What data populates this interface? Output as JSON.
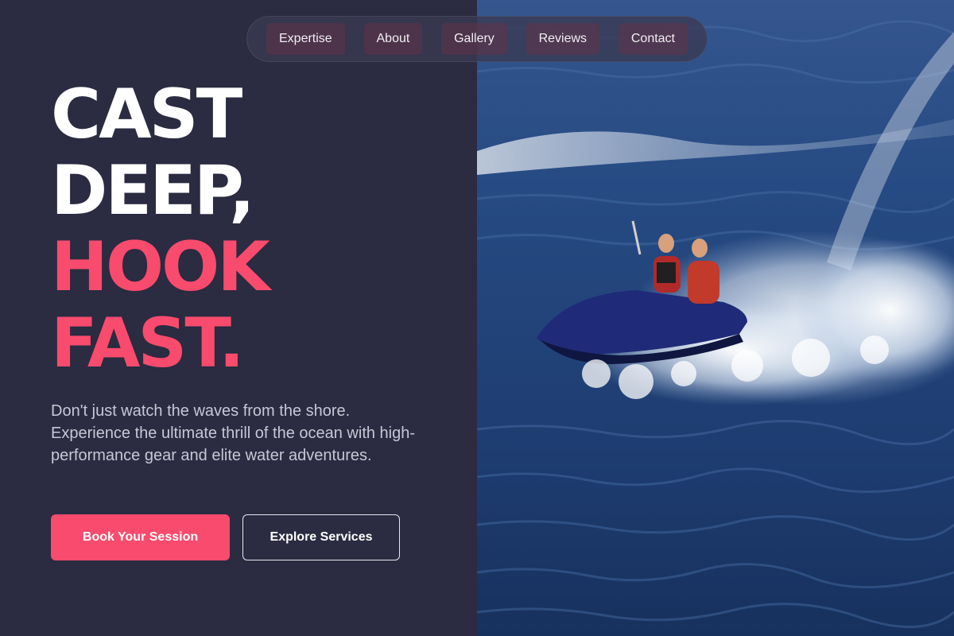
{
  "nav": {
    "items": [
      {
        "label": "Expertise"
      },
      {
        "label": "About"
      },
      {
        "label": "Gallery"
      },
      {
        "label": "Reviews"
      },
      {
        "label": "Contact"
      }
    ]
  },
  "hero": {
    "headline_line1": "CAST",
    "headline_line2": "DEEP,",
    "headline_line3": "HOOK",
    "headline_line4": "FAST.",
    "lead": "Don't just watch the waves from the shore. Experience the ultimate thrill of the ocean with high-performance gear and elite water adventures.",
    "primary_cta": "Book Your Session",
    "secondary_cta": "Explore Services"
  },
  "colors": {
    "background": "#2b2b41",
    "accent": "#f94b6d",
    "text": "#ffffff",
    "muted_text": "#c7c8d6"
  },
  "image": {
    "subject": "jet-ski-riders-image"
  }
}
